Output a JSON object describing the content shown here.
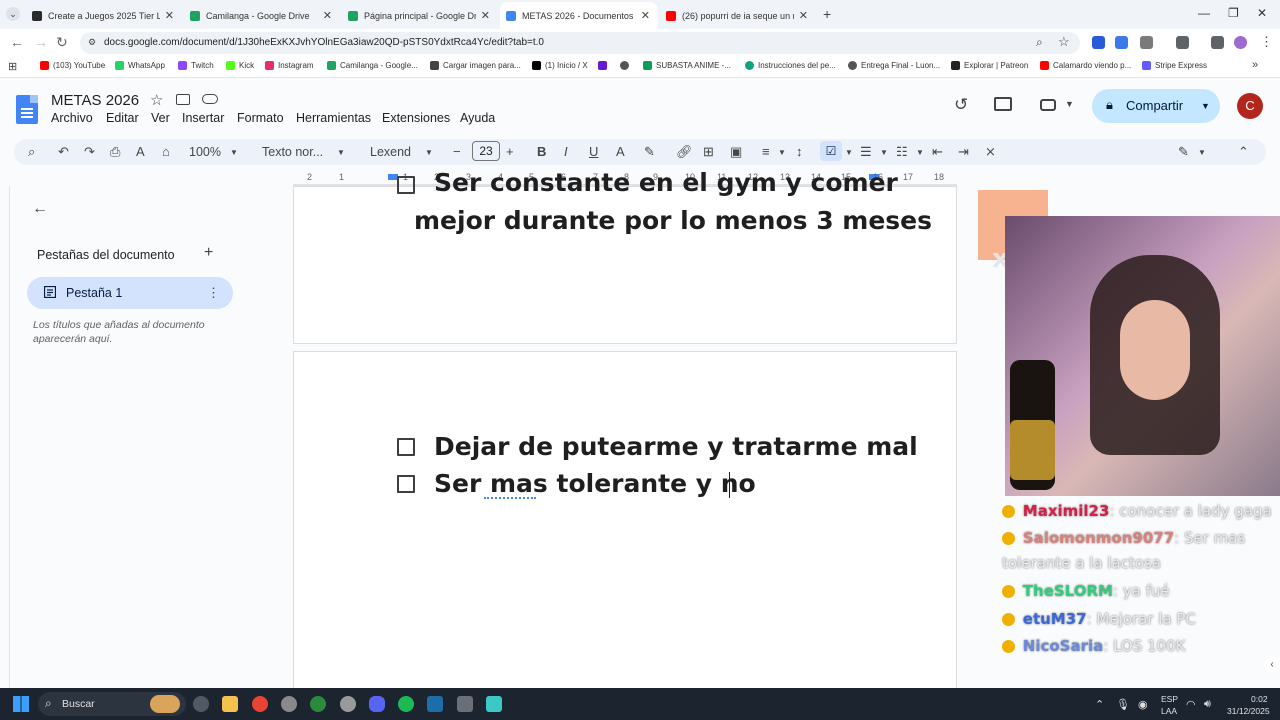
{
  "browser": {
    "tabs": [
      {
        "title": "Create a Juegos 2025 Tier List -",
        "color": "#2b2b2b"
      },
      {
        "title": "Camilanga - Google Drive",
        "color": "#1ea362"
      },
      {
        "title": "Página principal - Google Drive",
        "color": "#1ea362"
      },
      {
        "title": "METAS 2026 - Documentos de",
        "color": "#4285f4"
      },
      {
        "title": "(26) popurri de ia seque un ric",
        "color": "#ff0000"
      }
    ],
    "url": "docs.google.com/document/d/1J30heExKXJvhYOlnEGa3iaw20QD-pSTS0YdxtRca4Yc/edit?tab=t.0",
    "bookmarks": [
      {
        "label": "(103) YouTube",
        "color": "#ff0000"
      },
      {
        "label": "WhatsApp",
        "color": "#25d366"
      },
      {
        "label": "Twitch",
        "color": "#9146ff"
      },
      {
        "label": "Kick",
        "color": "#53fc18"
      },
      {
        "label": "Instagram",
        "color": "#e1306c"
      },
      {
        "label": "Camilanga - Google...",
        "color": "#1ea362"
      },
      {
        "label": "Cargar imagen para...",
        "color": "#444444"
      },
      {
        "label": "(1) Inicio / X",
        "color": "#000000"
      },
      {
        "label": "",
        "color": "#6a1bd1"
      },
      {
        "label": "",
        "color": "#555555"
      },
      {
        "label": "SUBASTA ANIME -...",
        "color": "#0f9d58"
      },
      {
        "label": "Instrucciones del pe...",
        "color": "#10a37f"
      },
      {
        "label": "Entrega Final - Luon...",
        "color": "#555555"
      },
      {
        "label": "Explorar | Patreon",
        "color": "#222222"
      },
      {
        "label": "Calamardo viendo p...",
        "color": "#ff0000"
      },
      {
        "label": "Stripe Express",
        "color": "#635bff"
      }
    ]
  },
  "docs": {
    "title": "METAS 2026",
    "menu": [
      "Archivo",
      "Editar",
      "Ver",
      "Insertar",
      "Formato",
      "Herramientas",
      "Extensiones",
      "Ayuda"
    ],
    "share_label": "Compartir",
    "avatar_initial": "C",
    "toolbar": {
      "zoom": "100%",
      "style": "Texto nor...",
      "font": "Lexend",
      "font_size": "23"
    },
    "ruler": [
      "2",
      "1",
      "1",
      "2",
      "3",
      "4",
      "5",
      "6",
      "7",
      "8",
      "9",
      "10",
      "11",
      "12",
      "13",
      "14",
      "15",
      "16",
      "17",
      "18"
    ],
    "side_panel": {
      "heading": "Pestañas del documento",
      "tab_label": "Pestaña 1",
      "hint": "Los títulos que añadas al documento aparecerán aquí."
    },
    "content": {
      "page1_line1": "Ser constante en el gym y comer",
      "page1_line2": "mejor durante por lo menos 3 meses",
      "checklist": [
        "Dejar de putearme y tratarme mal",
        "Ser mas tolerante y no"
      ]
    }
  },
  "stream": {
    "sticker_text": "x4",
    "chat": [
      {
        "user": "Maximil23",
        "user_color": "#d6204a",
        "message": ": conocer a lady gaga"
      },
      {
        "user": "Salomonmon9077",
        "user_color": "#d9817a",
        "message": ": Ser mas tolerante a la lactosa"
      },
      {
        "user": "TheSLORM",
        "user_color": "#2ecf7a",
        "message": ": ya fué"
      },
      {
        "user": "etuM37",
        "user_color": "#3a6ad8",
        "message": ": Mejorar la PC"
      },
      {
        "user": "NicoSaria",
        "user_color": "#6c8ad8",
        "message": ": LOS 100K"
      }
    ]
  },
  "taskbar": {
    "search_label": "Buscar",
    "lang_top": "ESP",
    "lang_bottom": "LAA",
    "time": "0:02",
    "date": "31/12/2025"
  }
}
